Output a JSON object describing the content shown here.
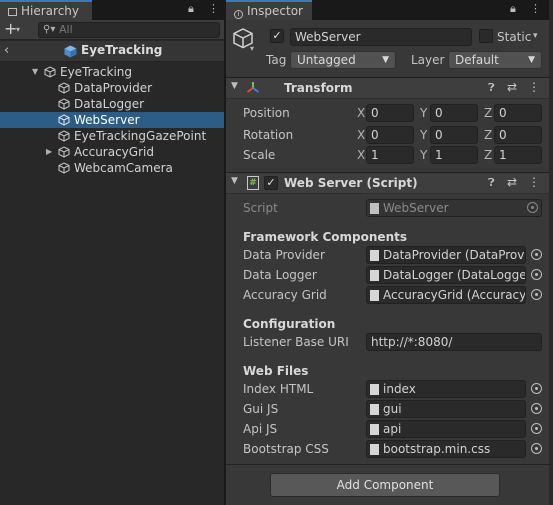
{
  "hierarchy": {
    "tab_label": "Hierarchy",
    "search_placeholder": "All",
    "scene_name": "EyeTracking",
    "tree": [
      {
        "label": "EyeTracking",
        "depth": 0,
        "expanded": true,
        "selected": false
      },
      {
        "label": "DataProvider",
        "depth": 1,
        "selected": false
      },
      {
        "label": "DataLogger",
        "depth": 1,
        "selected": false
      },
      {
        "label": "WebServer",
        "depth": 1,
        "selected": true
      },
      {
        "label": "EyeTrackingGazePoint",
        "depth": 1,
        "selected": false
      },
      {
        "label": "AccuracyGrid",
        "depth": 1,
        "collapsed": true,
        "selected": false
      },
      {
        "label": "WebcamCamera",
        "depth": 1,
        "selected": false
      }
    ]
  },
  "inspector": {
    "tab_label": "Inspector",
    "object_name": "WebServer",
    "static_label": "Static",
    "tag_label": "Tag",
    "tag_value": "Untagged",
    "layer_label": "Layer",
    "layer_value": "Default",
    "transform": {
      "title": "Transform",
      "rows": [
        {
          "label": "Position",
          "x": "0",
          "y": "0",
          "z": "0"
        },
        {
          "label": "Rotation",
          "x": "0",
          "y": "0",
          "z": "0"
        },
        {
          "label": "Scale",
          "x": "1",
          "y": "1",
          "z": "1"
        }
      ]
    },
    "script_component": {
      "title": "Web Server (Script)",
      "script_label": "Script",
      "script_value": "WebServer",
      "sections": {
        "framework": "Framework Components",
        "configuration": "Configuration",
        "web_files": "Web Files"
      },
      "framework_fields": [
        {
          "label": "Data Provider",
          "value": "DataProvider (DataProvid"
        },
        {
          "label": "Data Logger",
          "value": "DataLogger (DataLogger)"
        },
        {
          "label": "Accuracy Grid",
          "value": "AccuracyGrid (AccuracyG"
        }
      ],
      "listener_label": "Listener Base URI",
      "listener_value": "http://*:8080/",
      "web_file_fields": [
        {
          "label": "Index HTML",
          "value": "index"
        },
        {
          "label": "Gui JS",
          "value": "gui"
        },
        {
          "label": "Api JS",
          "value": "api"
        },
        {
          "label": "Bootstrap CSS",
          "value": "bootstrap.min.css"
        }
      ]
    },
    "add_component_label": "Add Component"
  },
  "colors": {
    "selection": "#2c5d87",
    "tab_accent": "#3a79bb",
    "panel_bg": "#383838"
  }
}
